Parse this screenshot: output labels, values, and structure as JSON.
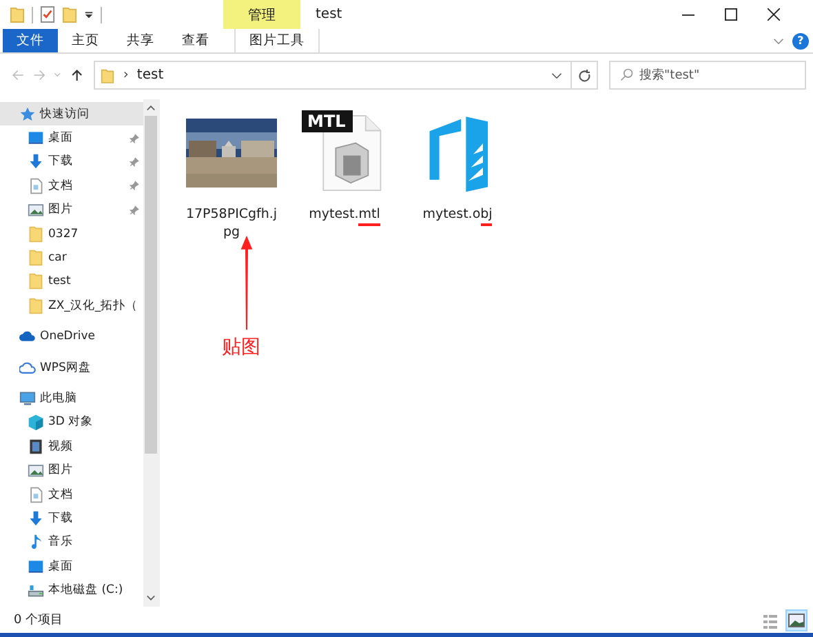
{
  "window": {
    "title": "test"
  },
  "ribbon": {
    "context_group": "管理",
    "help": "?",
    "tabs": [
      {
        "label": "文件",
        "kind": "file"
      },
      {
        "label": "主页",
        "kind": "plain"
      },
      {
        "label": "共享",
        "kind": "plain"
      },
      {
        "label": "查看",
        "kind": "plain"
      },
      {
        "label": "图片工具",
        "kind": "tool"
      }
    ]
  },
  "address": {
    "separator": "›",
    "path": "test",
    "search_placeholder": "搜索\"test\""
  },
  "sidebar": {
    "items": [
      {
        "label": "快速访问",
        "kind": "star",
        "selected": true,
        "children": [
          {
            "label": "桌面",
            "kind": "desktop",
            "pinned": true,
            "selected": false
          },
          {
            "label": "下载",
            "kind": "download",
            "pinned": true,
            "selected": false
          },
          {
            "label": "文档",
            "kind": "document",
            "pinned": true,
            "selected": false
          },
          {
            "label": "图片",
            "kind": "pictures",
            "pinned": true,
            "selected": false
          },
          {
            "label": "0327",
            "kind": "folder",
            "pinned": false,
            "selected": false
          },
          {
            "label": "car",
            "kind": "folder",
            "pinned": false,
            "selected": false
          },
          {
            "label": "test",
            "kind": "folder",
            "pinned": false,
            "selected": false
          },
          {
            "label": "ZX_汉化_拓扑（",
            "kind": "folder",
            "pinned": false,
            "selected": false
          }
        ]
      },
      {
        "label": "OneDrive",
        "kind": "cloud",
        "selected": false
      },
      {
        "label": "WPS网盘",
        "kind": "wps",
        "selected": false
      },
      {
        "label": "此电脑",
        "kind": "pc",
        "selected": false,
        "children": [
          {
            "label": "3D 对象",
            "kind": "cube",
            "pinned": false,
            "selected": false
          },
          {
            "label": "视频",
            "kind": "video",
            "pinned": false,
            "selected": false
          },
          {
            "label": "图片",
            "kind": "pictures",
            "pinned": false,
            "selected": false
          },
          {
            "label": "文档",
            "kind": "document",
            "pinned": false,
            "selected": false
          },
          {
            "label": "下载",
            "kind": "download",
            "pinned": false,
            "selected": false
          },
          {
            "label": "音乐",
            "kind": "music",
            "pinned": false,
            "selected": false
          },
          {
            "label": "桌面",
            "kind": "desktop",
            "pinned": false,
            "selected": false
          },
          {
            "label": "本地磁盘 (C:)",
            "kind": "drive",
            "pinned": false,
            "selected": false
          }
        ]
      }
    ]
  },
  "files": [
    {
      "kind": "picture",
      "name_parts": [
        "17P58PICgfh.jpg"
      ],
      "marked": false
    },
    {
      "kind": "mtl",
      "badge": "MTL",
      "name_parts": [
        "mytest.",
        "mtl"
      ],
      "marked": true
    },
    {
      "kind": "obj",
      "name_parts": [
        "mytest.o",
        "bj"
      ],
      "marked": true
    }
  ],
  "annotation": {
    "label": "贴图",
    "color": "#ff2020"
  },
  "status_bar": {
    "count": "0 个项目",
    "views": [
      {
        "kind": "details",
        "selected": false
      },
      {
        "kind": "large_icons",
        "selected": true
      }
    ]
  }
}
